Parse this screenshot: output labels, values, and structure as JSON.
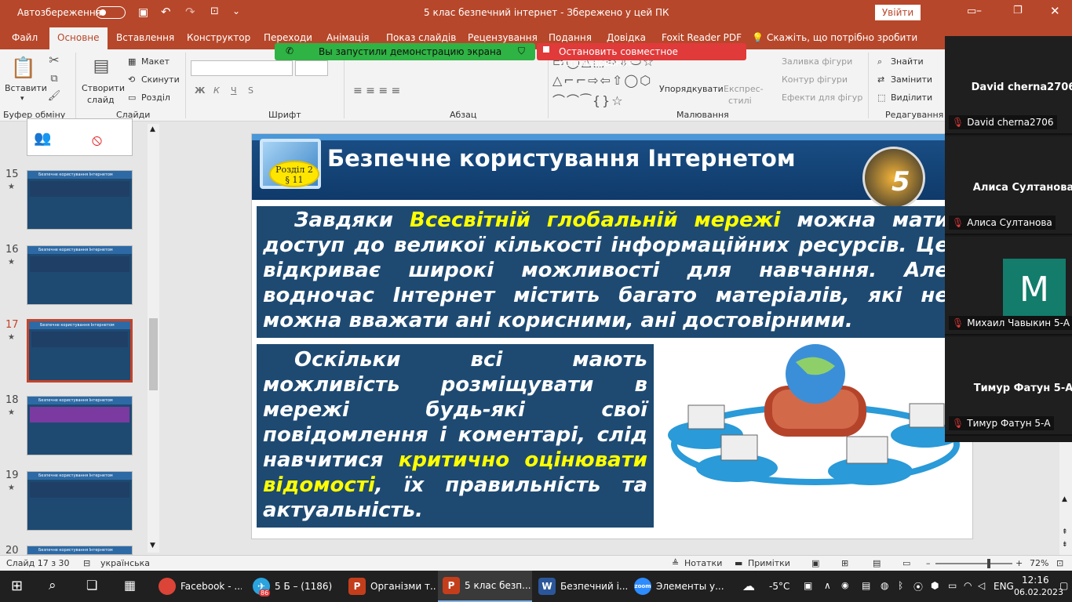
{
  "titlebar": {
    "autosave": "Автозбереження",
    "doc_title": "5 клас безпечний інтернет  -  Збережено у цей ПК",
    "signin": "Увійти"
  },
  "menu": [
    "Файл",
    "Основне",
    "Вставлення",
    "Конструктор",
    "Переходи",
    "Анімація",
    "Показ слайдів",
    "Рецензування",
    "Подання",
    "Довідка",
    "Foxit Reader PDF"
  ],
  "tellme": "Скажіть, що потрібно зробити",
  "share": {
    "started": "Вы запустили демонстрацию экрана",
    "stop": "Остановить совместное использование"
  },
  "ribbon": {
    "paste": "Вставити",
    "clipboard": "Буфер обміну",
    "new_slide": "Створити",
    "new_slide2": "слайд",
    "layout": "Макет",
    "reset": "Скинути",
    "section": "Розділ",
    "slides": "Слайди",
    "font": "Шрифт",
    "paragraph": "Абзац",
    "fill": "Заливка фігури",
    "outline": "Контур фігури",
    "effects": "Ефекти для фігур",
    "arrange": "Упорядкувати",
    "quickstyles": "Експрес-",
    "quickstyles2": "стилі",
    "drawing": "Малювання",
    "find": "Знайти",
    "replace": "Замінити",
    "select": "Виділити",
    "editing": "Редагування",
    "bold": "Ж",
    "italic": "К",
    "underline": "Ч",
    "strike": "S"
  },
  "thumbs": [
    {
      "num": "15",
      "title": "Безпечне користування Інтернетом"
    },
    {
      "num": "16",
      "title": "Безпечне користування Інтернетом"
    },
    {
      "num": "17",
      "title": "Безпечне користування Інтернетом"
    },
    {
      "num": "18",
      "title": "Безпечне користування Інтернетом"
    },
    {
      "num": "19",
      "title": "Безпечне користування Інтернетом"
    },
    {
      "num": "20",
      "title": "Безпечне користування Інтернетом"
    }
  ],
  "slide": {
    "title": "Безпечне користування Інтернетом",
    "badge1": "Розділ 2",
    "badge2": "§ 11",
    "emblem": "5",
    "p1_a": "Завдяки ",
    "p1_hl": "Всесвітній глобальній мережі",
    "p1_b": " можна мати доступ до великої кількості інформаційних ресурсів. Це відкриває широкі можливості для навчання. Але водночас Інтернет містить багато матеріалів, які не можна вважати ані корисними, ані достовірними.",
    "p2_a": "Оскільки всі мають можливість розміщувати в мережі будь-які свої повідомлення і коментарі, слід навчитися ",
    "p2_hl": "критично оцінювати відомості",
    "p2_b": ", їх правильність та актуальність."
  },
  "zoom": [
    {
      "name": "David cherna2706",
      "label": "David cherna2706"
    },
    {
      "name": "Алиса Султанова",
      "label": "Алиса Султанова"
    },
    {
      "name": "",
      "label": "Михаил Чавыкин 5-А",
      "avatar": "M"
    },
    {
      "name": "Тимур Фатун 5-А",
      "label": "Тимур Фатун 5-А"
    }
  ],
  "status": {
    "slide": "Слайд 17 з 30",
    "lang": "українська",
    "notes": "Нотатки",
    "comments": "Примітки",
    "zoom": "72%"
  },
  "taskbar": {
    "items": [
      {
        "label": "Facebook - ...",
        "color": "#db4437",
        "ic": "G"
      },
      {
        "label": "5 Б – (1186)",
        "color": "#2aa3df",
        "ic": "✈",
        "badge": "86"
      },
      {
        "label": "Організми т...",
        "color": "#c43e1c",
        "ic": "P"
      },
      {
        "label": "5 клас безп...",
        "color": "#c43e1c",
        "ic": "P"
      },
      {
        "label": "Безпечний і...",
        "color": "#2b579a",
        "ic": "W"
      },
      {
        "label": "Элементы у...",
        "color": "#2d8cff",
        "ic": "Z"
      }
    ],
    "temp": "-5°C",
    "lang": "ENG",
    "time": "12:16",
    "date": "06.02.2023"
  }
}
